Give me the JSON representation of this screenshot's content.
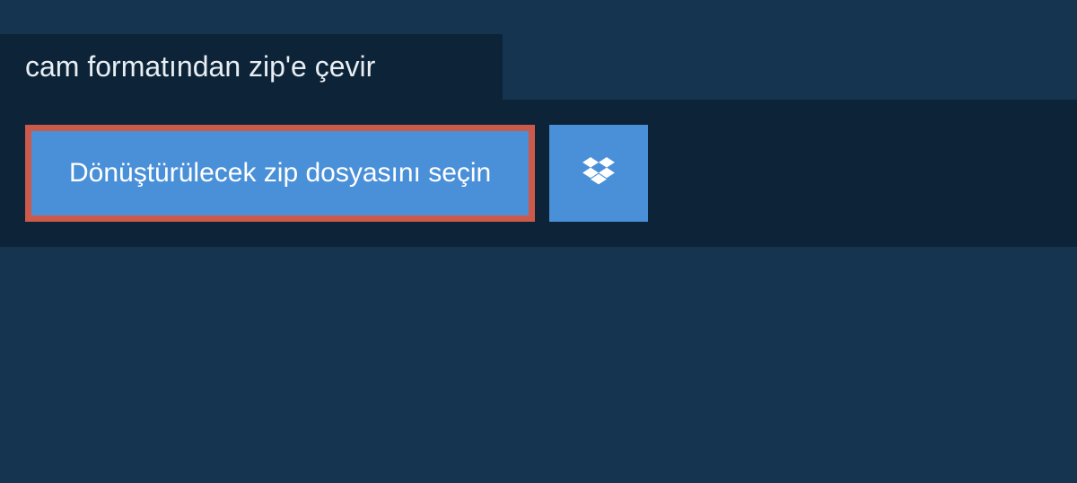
{
  "header": {
    "title": "cam formatından zip'e çevir"
  },
  "upload": {
    "select_button_label": "Dönüştürülecek zip dosyasını seçin",
    "dropbox_icon_name": "dropbox-icon"
  },
  "colors": {
    "background": "#153450",
    "panel": "#0d2438",
    "button": "#4a90d9",
    "highlight_border": "#cc5a4a",
    "text": "#e8eef3"
  }
}
